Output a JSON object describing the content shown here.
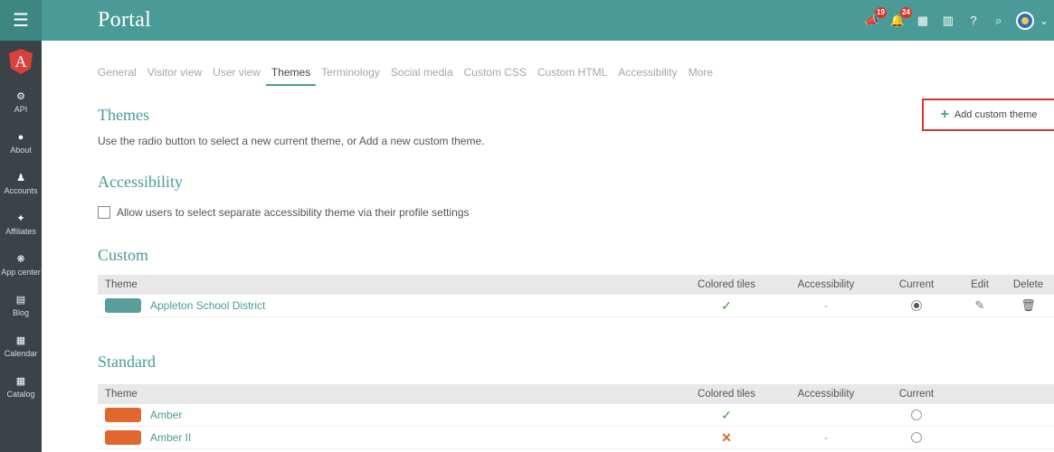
{
  "header": {
    "title": "Portal",
    "icons": [
      {
        "name": "megaphone-icon",
        "badge": "19"
      },
      {
        "name": "bell-icon",
        "badge": "24"
      },
      {
        "name": "calendar-icon",
        "badge": ""
      },
      {
        "name": "building-icon",
        "badge": ""
      },
      {
        "name": "help-icon",
        "badge": ""
      },
      {
        "name": "search-icon",
        "badge": ""
      }
    ]
  },
  "sidebar": {
    "logo": "A",
    "items": [
      {
        "label": "API",
        "icon": "gear-icon",
        "glyph": "⚙"
      },
      {
        "label": "About",
        "icon": "info-icon",
        "glyph": "●"
      },
      {
        "label": "Accounts",
        "icon": "users-icon",
        "glyph": "♟"
      },
      {
        "label": "Affiliates",
        "icon": "handshake-icon",
        "glyph": "✦"
      },
      {
        "label": "App center",
        "icon": "apps-icon",
        "glyph": "❋"
      },
      {
        "label": "Blog",
        "icon": "blog-icon",
        "glyph": "▤"
      },
      {
        "label": "Calendar",
        "icon": "calendar-icon",
        "glyph": "▦"
      },
      {
        "label": "Catalog",
        "icon": "grid-icon",
        "glyph": "▦"
      }
    ]
  },
  "tabs": [
    "General",
    "Visitor view",
    "User view",
    "Themes",
    "Terminology",
    "Social media",
    "Custom CSS",
    "Custom HTML",
    "Accessibility",
    "More"
  ],
  "active_tab": "Themes",
  "themes_section": {
    "title": "Themes",
    "description": "Use the radio button to select a new current theme, or Add a new custom theme.",
    "add_button": "Add custom theme"
  },
  "accessibility_section": {
    "title": "Accessibility",
    "checkbox_label": "Allow users to select separate accessibility theme via their profile settings"
  },
  "custom_section": {
    "title": "Custom",
    "headers": {
      "theme": "Theme",
      "tiles": "Colored tiles",
      "accessibility": "Accessibility",
      "current": "Current",
      "edit": "Edit",
      "delete": "Delete"
    },
    "rows": [
      {
        "name": "Appleton School District",
        "color": "#5a9e9c",
        "tiles": "✓",
        "accessibility": "-",
        "current": true
      }
    ]
  },
  "standard_section": {
    "title": "Standard",
    "headers": {
      "theme": "Theme",
      "tiles": "Colored tiles",
      "accessibility": "Accessibility",
      "current": "Current"
    },
    "rows": [
      {
        "name": "Amber",
        "color": "#e0682f",
        "tiles": "✓",
        "accessibility": "",
        "current": false
      },
      {
        "name": "Amber II",
        "color": "#e0682f",
        "tiles": "✕",
        "accessibility": "-",
        "current": false
      }
    ]
  },
  "colors": {
    "accent": "#4a9b97",
    "sidebar": "#3b4248",
    "highlight_border": "#d9342b"
  }
}
